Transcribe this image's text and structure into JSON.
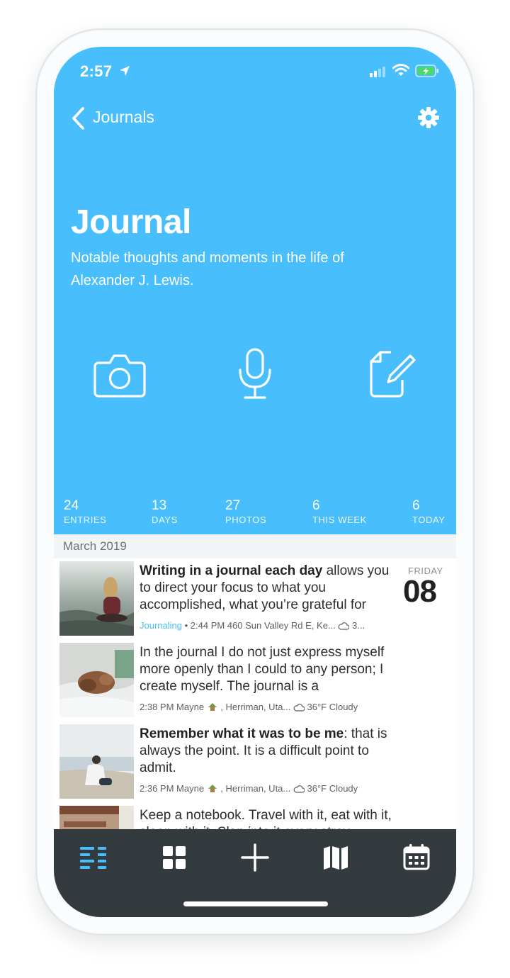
{
  "status_bar": {
    "time": "2:57"
  },
  "nav": {
    "back_label": "Journals"
  },
  "journal": {
    "title": "Journal",
    "subtitle": "Notable thoughts and moments in the life of Alexander J. Lewis."
  },
  "actions": [
    {
      "icon": "camera-icon"
    },
    {
      "icon": "microphone-icon"
    },
    {
      "icon": "compose-icon"
    }
  ],
  "stats": [
    {
      "value": "24",
      "label": "ENTRIES"
    },
    {
      "value": "13",
      "label": "DAYS"
    },
    {
      "value": "27",
      "label": "PHOTOS"
    },
    {
      "value": "6",
      "label": "THIS WEEK"
    },
    {
      "value": "6",
      "label": "TODAY"
    }
  ],
  "section": {
    "month": "March 2019"
  },
  "entries": [
    {
      "bold": "Writing in a journal each day",
      "text": " allows you to direct your focus to what you accomplished, what you’re grateful for",
      "tag": "Journaling",
      "meta": " • 2:44 PM 460 Sun Valley Rd E, Ke...",
      "weather": " 3...",
      "day_name": "FRIDAY",
      "day_num": "08"
    },
    {
      "bold": "",
      "text": "In the journal I do not just express myself more openly than I could to any person; I create myself. The journal is a",
      "time_place": "2:38 PM Mayne",
      "place_rest": " , Herriman, Uta...",
      "weather": " 36°F Cloudy"
    },
    {
      "bold": "Remember what it was to be me",
      "text": ": that is always the point. It is a difficult point to admit.",
      "time_place": "2:36 PM Mayne",
      "place_rest": " , Herriman, Uta...",
      "weather": " 36°F Cloudy"
    },
    {
      "bold": "",
      "text": "Keep a notebook. Travel with it, eat with it, sleep with it. Slap into it every stray"
    }
  ],
  "tabs": [
    {
      "name": "list",
      "icon": "list-icon",
      "active": true
    },
    {
      "name": "media",
      "icon": "grid-icon"
    },
    {
      "name": "new",
      "icon": "plus-icon"
    },
    {
      "name": "map",
      "icon": "map-icon"
    },
    {
      "name": "calendar",
      "icon": "calendar-icon"
    }
  ],
  "colors": {
    "accent": "#48bffc",
    "tabbar": "#343b3e",
    "battery": "#4cd964"
  }
}
